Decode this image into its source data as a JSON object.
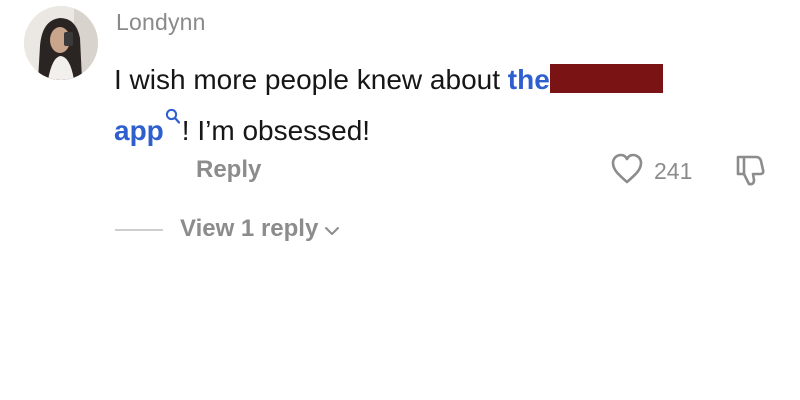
{
  "comment": {
    "username": "Londynn",
    "text_before": "I wish more people knew about ",
    "link_start": "the",
    "link_end": "app",
    "text_after": "! I’m obsessed!",
    "reply_label": "Reply",
    "like_count": "241",
    "view_replies_label": "View 1 reply"
  },
  "icons": {
    "like": "heart-icon",
    "dislike": "thumbs-down-icon",
    "search": "search-icon",
    "expand": "chevron-down-icon"
  },
  "colors": {
    "link": "#2f5fcf",
    "redaction": "#7a1414",
    "muted": "#8c8c8c",
    "text": "#161616"
  }
}
